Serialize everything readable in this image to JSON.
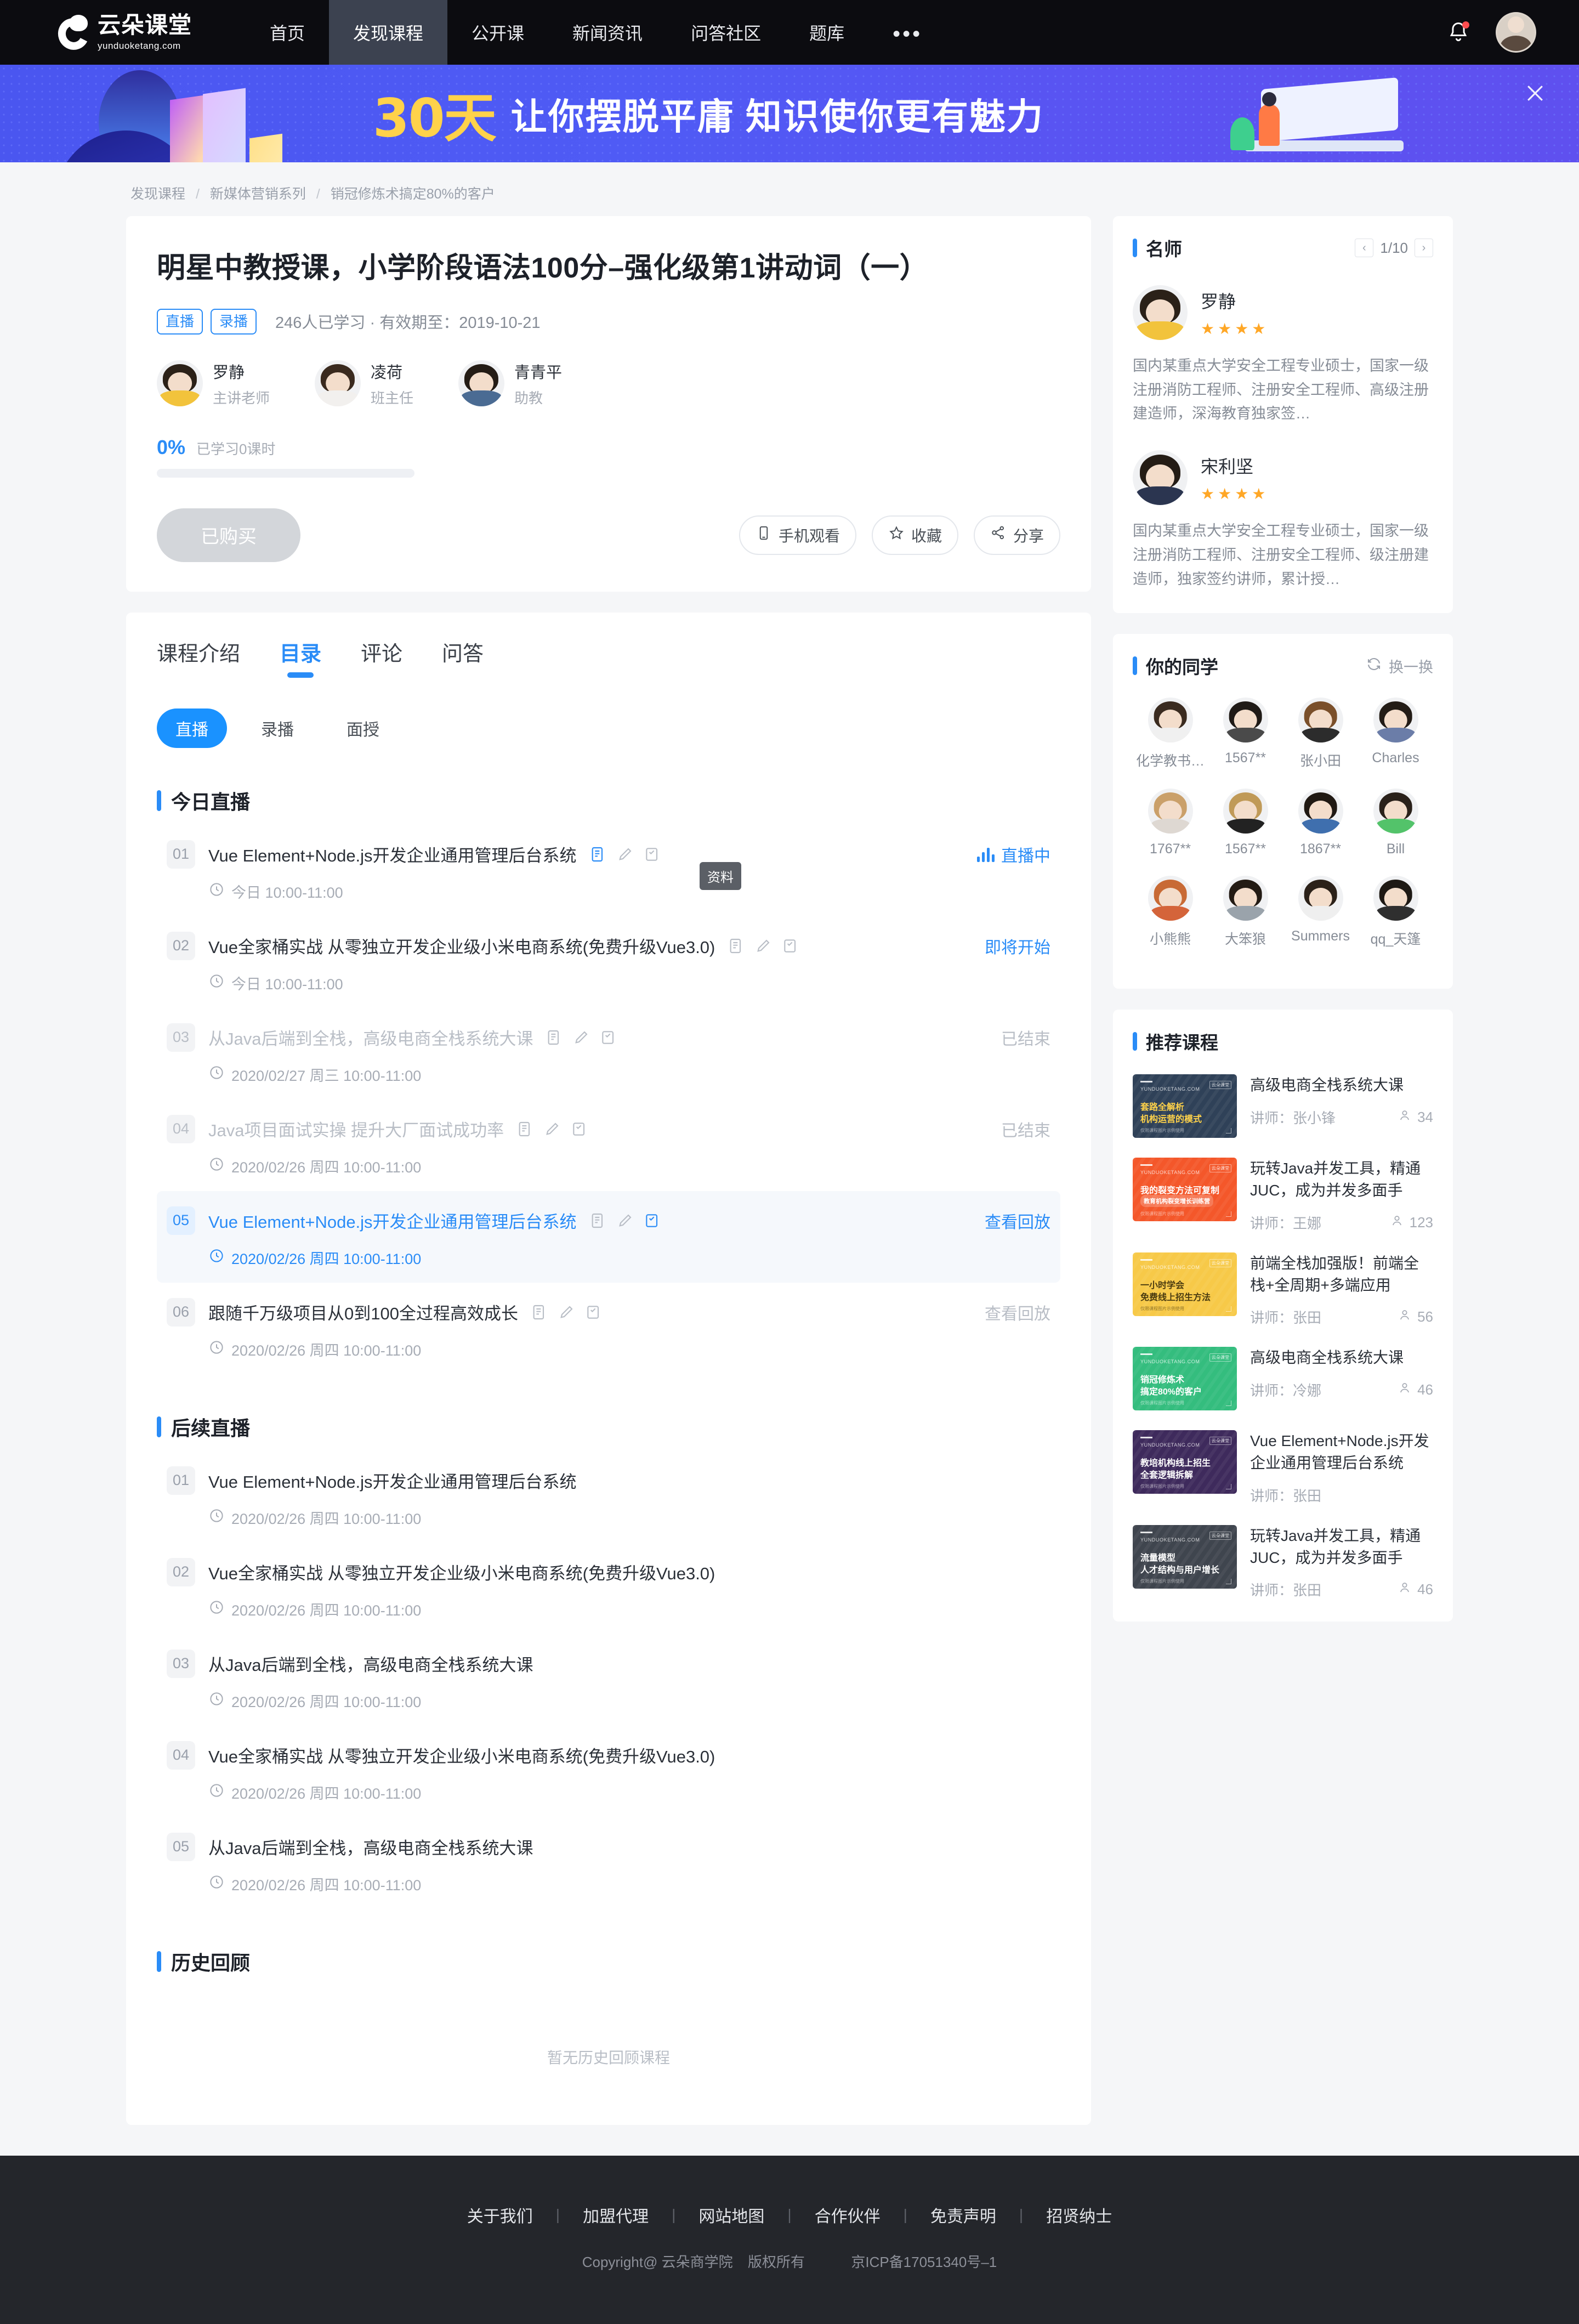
{
  "nav": {
    "logo_cn": "云朵课堂",
    "logo_en": "yunduoketang.com",
    "items": [
      {
        "label": "首页",
        "active": false
      },
      {
        "label": "发现课程",
        "active": true
      },
      {
        "label": "公开课",
        "active": false
      },
      {
        "label": "新闻资讯",
        "active": false
      },
      {
        "label": "问答社区",
        "active": false
      },
      {
        "label": "题库",
        "active": false
      },
      {
        "label": "•••",
        "active": false
      }
    ]
  },
  "banner": {
    "highlight": "30天",
    "text": "让你摆脱平庸 知识使你更有魅力"
  },
  "breadcrumb": [
    "发现课程",
    "新媒体营销系列",
    "销冠修炼术搞定80%的客户"
  ],
  "course": {
    "title": "明星中教授课，小学阶段语法100分–强化级第1讲动词（一）",
    "tags": [
      "直播",
      "录播"
    ],
    "meta": "246人已学习 · 有效期至：2019-10-21",
    "teachers": [
      {
        "name": "罗静",
        "role": "主讲老师"
      },
      {
        "name": "凌荷",
        "role": "班主任"
      },
      {
        "name": "青青平",
        "role": "助教"
      }
    ],
    "progress_pct": "0%",
    "progress_label": "已学习0课时",
    "buy_label": "已购买",
    "actions": [
      {
        "label": "手机观看",
        "icon": "phone-icon"
      },
      {
        "label": "收藏",
        "icon": "star-icon"
      },
      {
        "label": "分享",
        "icon": "share-icon"
      }
    ]
  },
  "catalog": {
    "tabs": [
      {
        "label": "课程介绍",
        "active": false
      },
      {
        "label": "目录",
        "active": true
      },
      {
        "label": "评论",
        "active": false
      },
      {
        "label": "问答",
        "active": false
      }
    ],
    "pills": [
      {
        "label": "直播",
        "active": true
      },
      {
        "label": "录播",
        "active": false
      },
      {
        "label": "面授",
        "active": false
      }
    ],
    "tooltip": "资料",
    "sections": [
      {
        "title": "今日直播",
        "lessons": [
          {
            "idx": "01",
            "name": "Vue Element+Node.js开发企业通用管理后台系统",
            "time": "今日 10:00-11:00",
            "status": "直播中",
            "status_type": "live",
            "icons": true,
            "state": "normal"
          },
          {
            "idx": "02",
            "name": "Vue全家桶实战 从零独立开发企业级小米电商系统(免费升级Vue3.0)",
            "time": "今日 10:00-11:00",
            "status": "即将开始",
            "status_type": "soon",
            "icons": true,
            "state": "normal"
          },
          {
            "idx": "03",
            "name": "从Java后端到全栈，高级电商全栈系统大课",
            "time": "2020/02/27 周三 10:00-11:00",
            "status": "已结束",
            "status_type": "end",
            "icons": true,
            "state": "muted"
          },
          {
            "idx": "04",
            "name": "Java项目面试实操 提升大厂面试成功率",
            "time": "2020/02/26 周四 10:00-11:00",
            "status": "已结束",
            "status_type": "end",
            "icons": true,
            "state": "muted"
          },
          {
            "idx": "05",
            "name": "Vue Element+Node.js开发企业通用管理后台系统",
            "time": "2020/02/26 周四 10:00-11:00",
            "status": "查看回放",
            "status_type": "replay",
            "icons": true,
            "state": "highlight"
          },
          {
            "idx": "06",
            "name": "跟随千万级项目从0到100全过程高效成长",
            "time": "2020/02/26 周四 10:00-11:00",
            "status": "查看回放",
            "status_type": "replay",
            "icons": true,
            "state": "normal"
          }
        ]
      },
      {
        "title": "后续直播",
        "lessons": [
          {
            "idx": "01",
            "name": "Vue Element+Node.js开发企业通用管理后台系统",
            "time": "2020/02/26 周四 10:00-11:00",
            "status": "",
            "status_type": "none",
            "icons": false,
            "state": "normal"
          },
          {
            "idx": "02",
            "name": "Vue全家桶实战 从零独立开发企业级小米电商系统(免费升级Vue3.0)",
            "time": "2020/02/26 周四 10:00-11:00",
            "status": "",
            "status_type": "none",
            "icons": false,
            "state": "normal"
          },
          {
            "idx": "03",
            "name": "从Java后端到全栈，高级电商全栈系统大课",
            "time": "2020/02/26 周四 10:00-11:00",
            "status": "",
            "status_type": "none",
            "icons": false,
            "state": "normal"
          },
          {
            "idx": "04",
            "name": "Vue全家桶实战 从零独立开发企业级小米电商系统(免费升级Vue3.0)",
            "time": "2020/02/26 周四 10:00-11:00",
            "status": "",
            "status_type": "none",
            "icons": false,
            "state": "normal"
          },
          {
            "idx": "05",
            "name": "从Java后端到全栈，高级电商全栈系统大课",
            "time": "2020/02/26 周四 10:00-11:00",
            "status": "",
            "status_type": "none",
            "icons": false,
            "state": "normal"
          }
        ]
      }
    ],
    "history": {
      "title": "历史回顾",
      "empty": "暂无历史回顾课程"
    }
  },
  "sidebar": {
    "famous": {
      "title": "名师",
      "page": "1/10",
      "teachers": [
        {
          "name": "罗静",
          "stars": 4,
          "desc": "国内某重点大学安全工程专业硕士，国家一级注册消防工程师、注册安全工程师、高级注册建造师，深海教育独家签…",
          "hair": "#2b2118",
          "torso": "#f2c33c"
        },
        {
          "name": "宋利坚",
          "stars": 4,
          "desc": "国内某重点大学安全工程专业硕士，国家一级注册消防工程师、注册安全工程师、级注册建造师，独家签约讲师，累计授…",
          "hair": "#241c15",
          "torso": "#2b3550"
        }
      ]
    },
    "classmates": {
      "title": "你的同学",
      "refresh_label": "换一换",
      "items": [
        {
          "name": "化学教书…",
          "hair": "#3a2b20",
          "torso": "#f0f0f0"
        },
        {
          "name": "1567**",
          "hair": "#1f1a16",
          "torso": "#4a4a4a"
        },
        {
          "name": "张小田",
          "hair": "#7a4f2a",
          "torso": "#2c2c2c"
        },
        {
          "name": "Charles",
          "hair": "#231c16",
          "torso": "#6b7da8"
        },
        {
          "name": "1767**",
          "hair": "#caa06a",
          "torso": "#ded8d2"
        },
        {
          "name": "1567**",
          "hair": "#c09a58",
          "torso": "#222222"
        },
        {
          "name": "1867**",
          "hair": "#201913",
          "torso": "#3f6fae"
        },
        {
          "name": "Bill",
          "hair": "#2a211a",
          "torso": "#53c36a"
        },
        {
          "name": "小熊熊",
          "hair": "#c86a35",
          "torso": "#d4643a"
        },
        {
          "name": "大笨狼",
          "hair": "#231b14",
          "torso": "#9aa3ab"
        },
        {
          "name": "Summers",
          "hair": "#2b2119",
          "torso": "#efefef"
        },
        {
          "name": "qq_天篷",
          "hair": "#1e1914",
          "torso": "#2f2f2f"
        }
      ]
    },
    "recommended": {
      "title": "推荐课程",
      "items": [
        {
          "title": "高级电商全栈系统大课",
          "teacher_label": "讲师：张小锋",
          "count": "34",
          "thumb_bg": "#2f4158",
          "thumb_l1": "套路全解析",
          "thumb_l2": "机构运营的模式",
          "accent": true
        },
        {
          "title": "玩转Java并发工具，精通JUC，成为并发多面手",
          "teacher_label": "讲师：王娜",
          "count": "123",
          "thumb_bg": "#f4572a",
          "thumb_l1": "我的裂变方法可复制",
          "thumb_l2": "教育机构裂变增长训练营",
          "accent": false
        },
        {
          "title": "前端全栈加强版！前端全栈+全周期+多端应用",
          "teacher_label": "讲师：张田",
          "count": "56",
          "thumb_bg": "#f7c948",
          "thumb_l1": "一小时学会",
          "thumb_l2": "免费线上招生方法",
          "accent": false
        },
        {
          "title": "高级电商全栈系统大课",
          "teacher_label": "讲师：冷娜",
          "count": "46",
          "thumb_bg": "#34bd7e",
          "thumb_l1": "销冠修炼术",
          "thumb_l2": "搞定80%的客户",
          "accent": false
        },
        {
          "title": "Vue Element+Node.js开发企业通用管理后台系统",
          "teacher_label": "讲师：张田",
          "count": "",
          "thumb_bg": "#3e2a5c",
          "thumb_l1": "教培机构线上招生",
          "thumb_l2": "全套逻辑拆解",
          "accent": false
        },
        {
          "title": "玩转Java并发工具，精通JUC，成为并发多面手",
          "teacher_label": "讲师：张田",
          "count": "46",
          "thumb_bg": "#3f454e",
          "thumb_l1": "流量模型",
          "thumb_l2": "人才结构与用户增长",
          "accent": false
        }
      ],
      "thumb_brand": "YUNDUOKETANG.COM",
      "thumb_badge": "云朵课堂",
      "thumb_foot": "仅限课程图片示例使用"
    }
  },
  "footer": {
    "links": [
      "关于我们",
      "加盟代理",
      "网站地图",
      "合作伙伴",
      "免责声明",
      "招贤纳士"
    ],
    "copyright": "Copyright@ 云朵商学院",
    "rights": "版权所有",
    "icp": "京ICP备17051340号–1"
  },
  "colors": {
    "accent": "#2a8cf7",
    "nav_bg": "#0c0c10",
    "banner_bg": "#4f5bf5",
    "star": "#ffa726"
  }
}
